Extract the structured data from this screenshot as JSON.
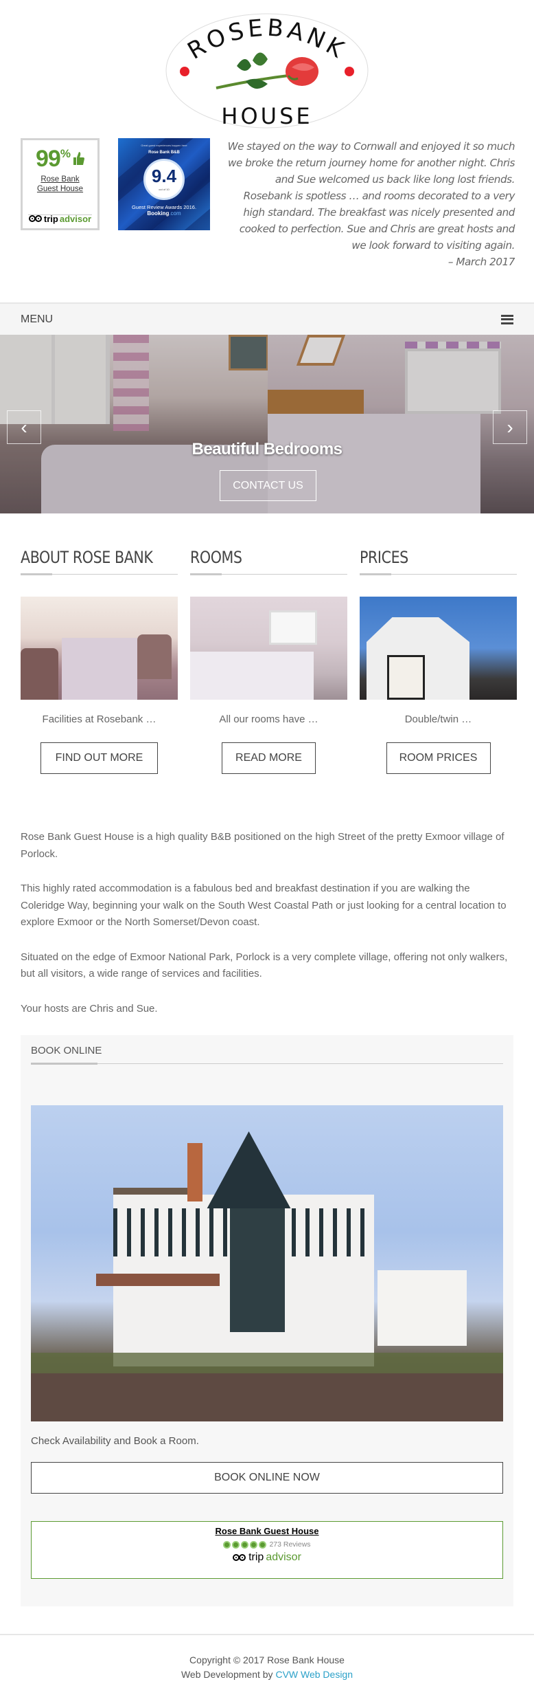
{
  "logo": {
    "line1": "ROSEBANK",
    "line2": "HOUSE",
    "icon": "rose-icon"
  },
  "badges": {
    "tripadvisor": {
      "percent": "99",
      "percent_symbol": "%",
      "name_line1": "Rose Bank",
      "name_line2": "Guest House",
      "brand_trip": "trip",
      "brand_advisor": "advisor"
    },
    "booking": {
      "tagline": "Great guest experiences happen here",
      "property": "Rose Bank B&B",
      "score": "9.4",
      "out_of": "out of 10",
      "award": "Guest Review Awards 2016.",
      "brand_booking": "Booking",
      "brand_com": ".com"
    }
  },
  "testimonial": {
    "text": "We stayed on the way to Cornwall and enjoyed it so much we broke the return journey home for another night. Chris and Sue welcomed us back like long lost friends. Rosebank is spotless … and rooms decorated to a very high standard. The breakfast was nicely presented and cooked to perfection. Sue and Chris are great hosts and we look forward to visiting again.",
    "date": "– March 2017"
  },
  "menu": {
    "label": "MENU",
    "icon": "hamburger-icon"
  },
  "hero": {
    "caption": "Beautiful Bedrooms",
    "cta": "CONTACT US",
    "prev_icon": "chevron-left-icon",
    "next_icon": "chevron-right-icon",
    "prev_glyph": "‹",
    "next_glyph": "›"
  },
  "features": [
    {
      "title": "ABOUT ROSE BANK",
      "blurb": "Facilities at Rosebank …",
      "button": "FIND OUT MORE"
    },
    {
      "title": "ROOMS",
      "blurb": "All our rooms have …",
      "button": "READ MORE"
    },
    {
      "title": "PRICES",
      "blurb": "Double/twin …",
      "button": "ROOM PRICES"
    }
  ],
  "about": {
    "paragraphs": [
      "Rose Bank Guest House is a high quality B&B positioned on the high Street of the pretty Exmoor village of Porlock.",
      "This highly rated accommodation is a fabulous bed and breakfast destination if you are walking the Coleridge Way, beginning your walk on the South West Coastal Path or just looking for a central location to explore Exmoor or the North Somerset/Devon coast.",
      "Situated on the edge of Exmoor National Park, Porlock is a very complete village, offering not only walkers, but all visitors, a wide range of services and facilities.",
      "Your hosts are Chris and Sue."
    ]
  },
  "book_online": {
    "heading": "BOOK ONLINE",
    "check_text": "Check Availability and Book a Room.",
    "button": "BOOK ONLINE NOW",
    "widget": {
      "name": "Rose Bank Guest House",
      "rating_bubbles": 5,
      "reviews": "273 Reviews",
      "brand_trip": "trip",
      "brand_advisor": "advisor"
    }
  },
  "footer": {
    "copyright": "Copyright © 2017 Rose Bank House",
    "credit_prefix": "Web Development by ",
    "credit_link": "CVW Web Design"
  },
  "colors": {
    "tripadvisor_green": "#5b9a31",
    "logo_red": "#e8202a",
    "link_blue": "#2aa0c8",
    "booking_blue": "#143a8a"
  }
}
